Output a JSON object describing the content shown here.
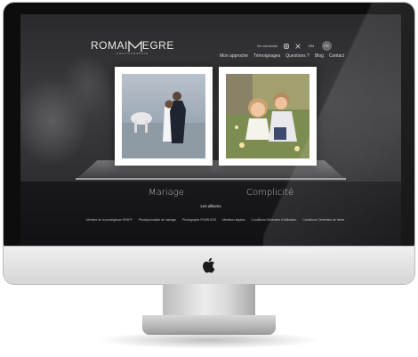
{
  "header": {
    "logo_text_left": "ROMAI",
    "logo_text_right": "EGRE",
    "logo_subtitle": "PHOTOGRAPHIE",
    "login_link": "Se connecter",
    "lang_en": "EN",
    "lang_fr": "FR"
  },
  "nav": {
    "items": [
      "Mon approche",
      "Témoignages",
      "Questions ?",
      "Blog",
      "Contact"
    ]
  },
  "gallery": {
    "captions": [
      "Mariage",
      "Complicité"
    ]
  },
  "footer": {
    "albums_title": "Les albums",
    "links": [
      "Membre de la prestigieuse SPAFP",
      "Photojournaliste de mariage",
      "Photographe FEARLESS",
      "Mentions légales",
      "Conditions Générales d'Utilisation",
      "Conditions Générales de Vente"
    ]
  },
  "colors": {
    "monitor_bezel": "#0d0d0e",
    "monitor_chin": "#e6e6e6",
    "site_text": "#d8d8d8"
  },
  "icons": [
    "apple-logo-icon",
    "instagram-icon",
    "x-twitter-icon"
  ]
}
